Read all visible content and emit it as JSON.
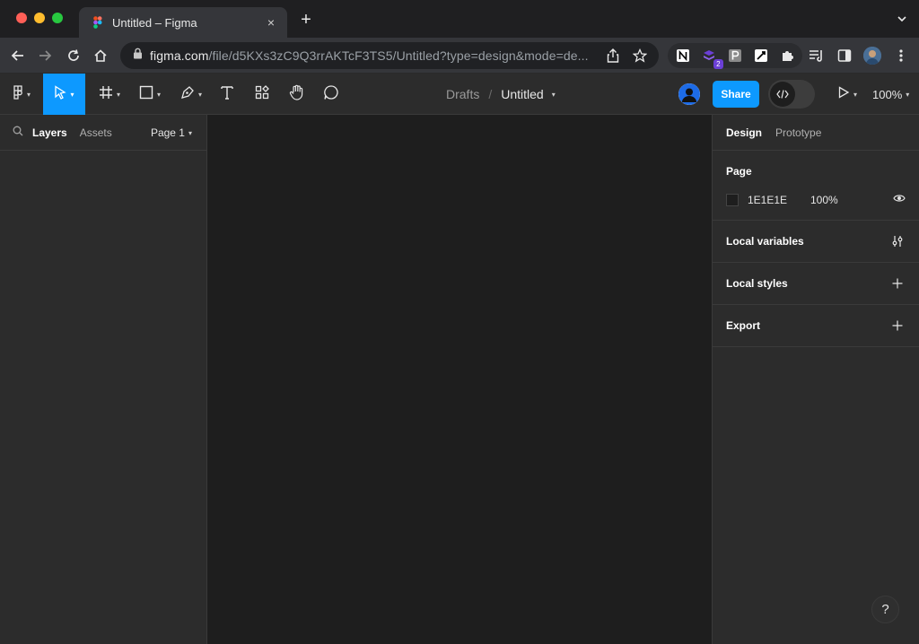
{
  "browser": {
    "tab_title": "Untitled – Figma",
    "tab_close": "×",
    "new_tab": "+",
    "url_host": "figma.com",
    "url_path": "/file/d5KXs3zC9Q3rrAKTcF3TS5/Untitled?type=design&mode=de...",
    "ext_badge": "2"
  },
  "toolbar": {
    "breadcrumb_parent": "Drafts",
    "breadcrumb_separator": "/",
    "file_name": "Untitled",
    "share_label": "Share",
    "zoom_level": "100%",
    "accent_color": "#0d99ff"
  },
  "left_panel": {
    "tabs": [
      {
        "label": "Layers",
        "active": true
      },
      {
        "label": "Assets",
        "active": false
      }
    ],
    "page_selector": "Page 1"
  },
  "right_panel": {
    "tabs": [
      {
        "label": "Design",
        "active": true
      },
      {
        "label": "Prototype",
        "active": false
      }
    ],
    "page_section": {
      "title": "Page",
      "background_hex": "1E1E1E",
      "opacity": "100%"
    },
    "sections": [
      {
        "title": "Local variables",
        "icon": "sliders-icon"
      },
      {
        "title": "Local styles",
        "icon": "plus-icon"
      },
      {
        "title": "Export",
        "icon": "plus-icon"
      }
    ]
  },
  "help": {
    "label": "?"
  }
}
